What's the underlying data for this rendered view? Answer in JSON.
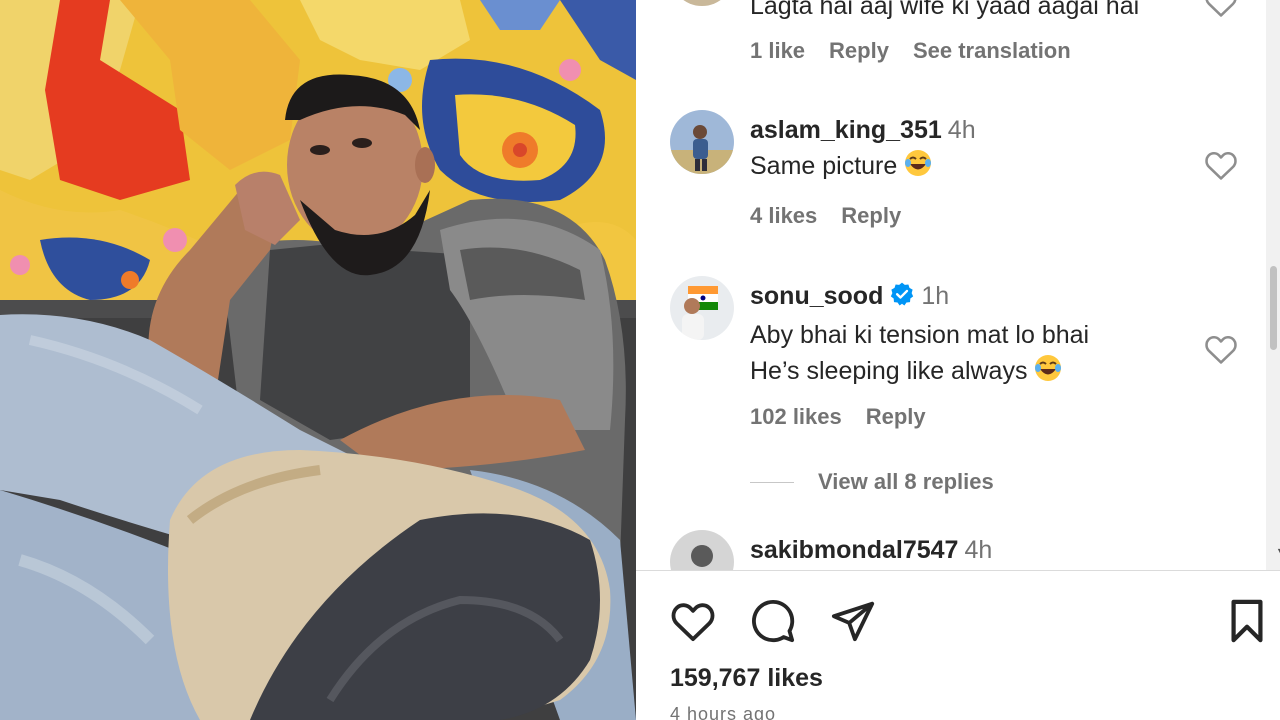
{
  "comments": [
    {
      "text": "Lagta hai aaj wife ki yaad aagai hai",
      "likes": "1 like",
      "reply": "Reply",
      "translate": "See translation"
    },
    {
      "username": "aslam_king_351",
      "time": "4h",
      "text": "Same picture",
      "emoji": "laughing-emoji",
      "likes": "4 likes",
      "reply": "Reply"
    },
    {
      "username": "sonu_sood",
      "verified": true,
      "time": "1h",
      "text_line1": "Aby bhai ki tension mat lo bhai",
      "text_line2": "He’s sleeping like always",
      "emoji": "laughing-emoji",
      "likes": "102 likes",
      "reply": "Reply",
      "view_replies": "View all 8 replies"
    },
    {
      "username": "sakibmondal7547",
      "time": "4h"
    }
  ],
  "actions": {
    "like_icon": "heart-icon",
    "comment_icon": "comment-icon",
    "share_icon": "share-icon",
    "save_icon": "bookmark-icon"
  },
  "post": {
    "likes": "159,767 likes",
    "time_ago": "4 hours ago"
  },
  "colors": {
    "text": "#262626",
    "secondary": "#737373",
    "verified": "#0095f6",
    "divider": "#dbdbdb"
  }
}
